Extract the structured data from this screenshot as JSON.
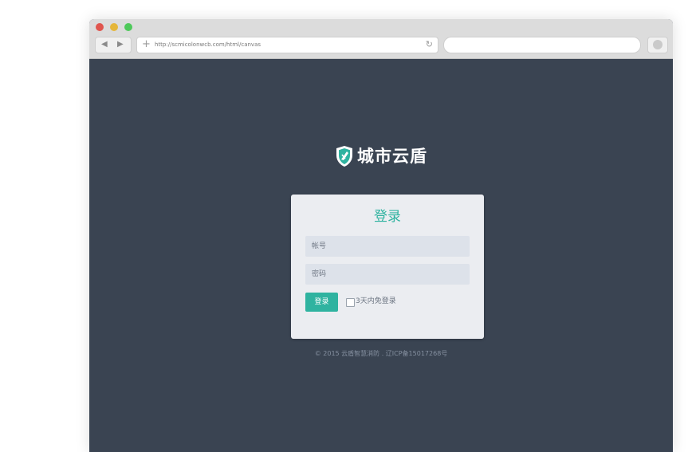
{
  "browser": {
    "url": "http://scmicolonwcb.com/html/canvas",
    "nav_back_glyph": "◀",
    "nav_forward_glyph": "▶",
    "new_tab_glyph": "+",
    "reload_glyph": "↻",
    "icons": [
      "close-light-icon",
      "minimize-light-icon",
      "maximize-light-icon",
      "plus-icon",
      "reload-icon",
      "extension-icon"
    ]
  },
  "brand": {
    "name": "城市云盾",
    "logo_icon": "shield-icon",
    "accent_color": "#2fb3a0",
    "background_color": "#3a4452"
  },
  "login": {
    "title": "登录",
    "username_placeholder": "帐号",
    "password_placeholder": "密码",
    "submit_label": "登录",
    "remember_label": "3天内免登录"
  },
  "footer": {
    "text": "© 2015 云盾智慧消防 . 辽ICP备15017268号"
  }
}
